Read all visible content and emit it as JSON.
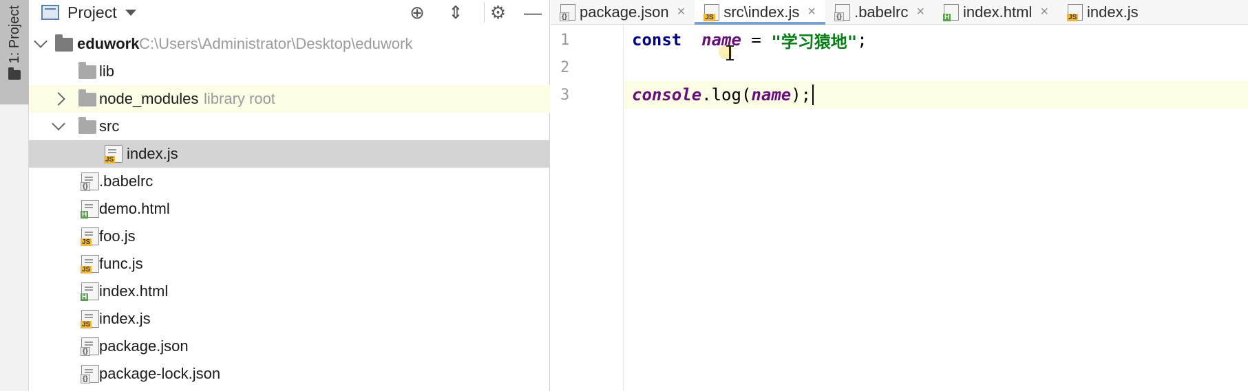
{
  "toolwindow": {
    "label": "1: Project",
    "icon": "folder-icon"
  },
  "project_panel": {
    "title": "Project",
    "actions": [
      {
        "name": "locate-icon",
        "glyph": "⊕"
      },
      {
        "name": "collapse-all-icon",
        "glyph": "⇕"
      },
      {
        "name": "gear-icon",
        "glyph": "⚙"
      },
      {
        "name": "minimize-icon",
        "glyph": "—"
      }
    ],
    "root": {
      "name": "eduwork",
      "path": "C:\\Users\\Administrator\\Desktop\\eduwork"
    },
    "items": [
      {
        "label": "lib",
        "hint": ""
      },
      {
        "label": "node_modules",
        "hint": "library root"
      },
      {
        "label": "src",
        "hint": ""
      },
      {
        "label": "index.js",
        "hint": ""
      },
      {
        "label": ".babelrc",
        "hint": ""
      },
      {
        "label": "demo.html",
        "hint": ""
      },
      {
        "label": "foo.js",
        "hint": ""
      },
      {
        "label": "func.js",
        "hint": ""
      },
      {
        "label": "index.html",
        "hint": ""
      },
      {
        "label": "index.js",
        "hint": ""
      },
      {
        "label": "package.json",
        "hint": ""
      },
      {
        "label": "package-lock.json",
        "hint": ""
      }
    ]
  },
  "editor": {
    "tabs": [
      {
        "label": "package.json",
        "icon": "config-file-icon",
        "close": "×"
      },
      {
        "label": "src\\index.js",
        "icon": "js-file-icon",
        "close": "×"
      },
      {
        "label": ".babelrc",
        "icon": "config-file-icon",
        "close": "×"
      },
      {
        "label": "index.html",
        "icon": "html-file-icon",
        "close": "×"
      },
      {
        "label": "index.js",
        "icon": "js-file-icon",
        "close": ""
      }
    ],
    "line_numbers": [
      "1",
      "2",
      "3"
    ],
    "code": {
      "l1_kw": "const",
      "l1_var": "name",
      "l1_eq": " = ",
      "l1_str": "\"学习猿地\"",
      "l1_end": ";",
      "l3_obj": "console",
      "l3_dot": ".",
      "l3_fn": "log",
      "l3_open": "(",
      "l3_arg": "name",
      "l3_close": ");"
    }
  },
  "badges": {
    "js": "JS",
    "html": "H",
    "config": "{}"
  },
  "colors": {
    "keyword": "#000080",
    "variable": "#660e7a",
    "string": "#067d17",
    "current_line": "#fdfde6",
    "selection": "#d4d4d4"
  }
}
